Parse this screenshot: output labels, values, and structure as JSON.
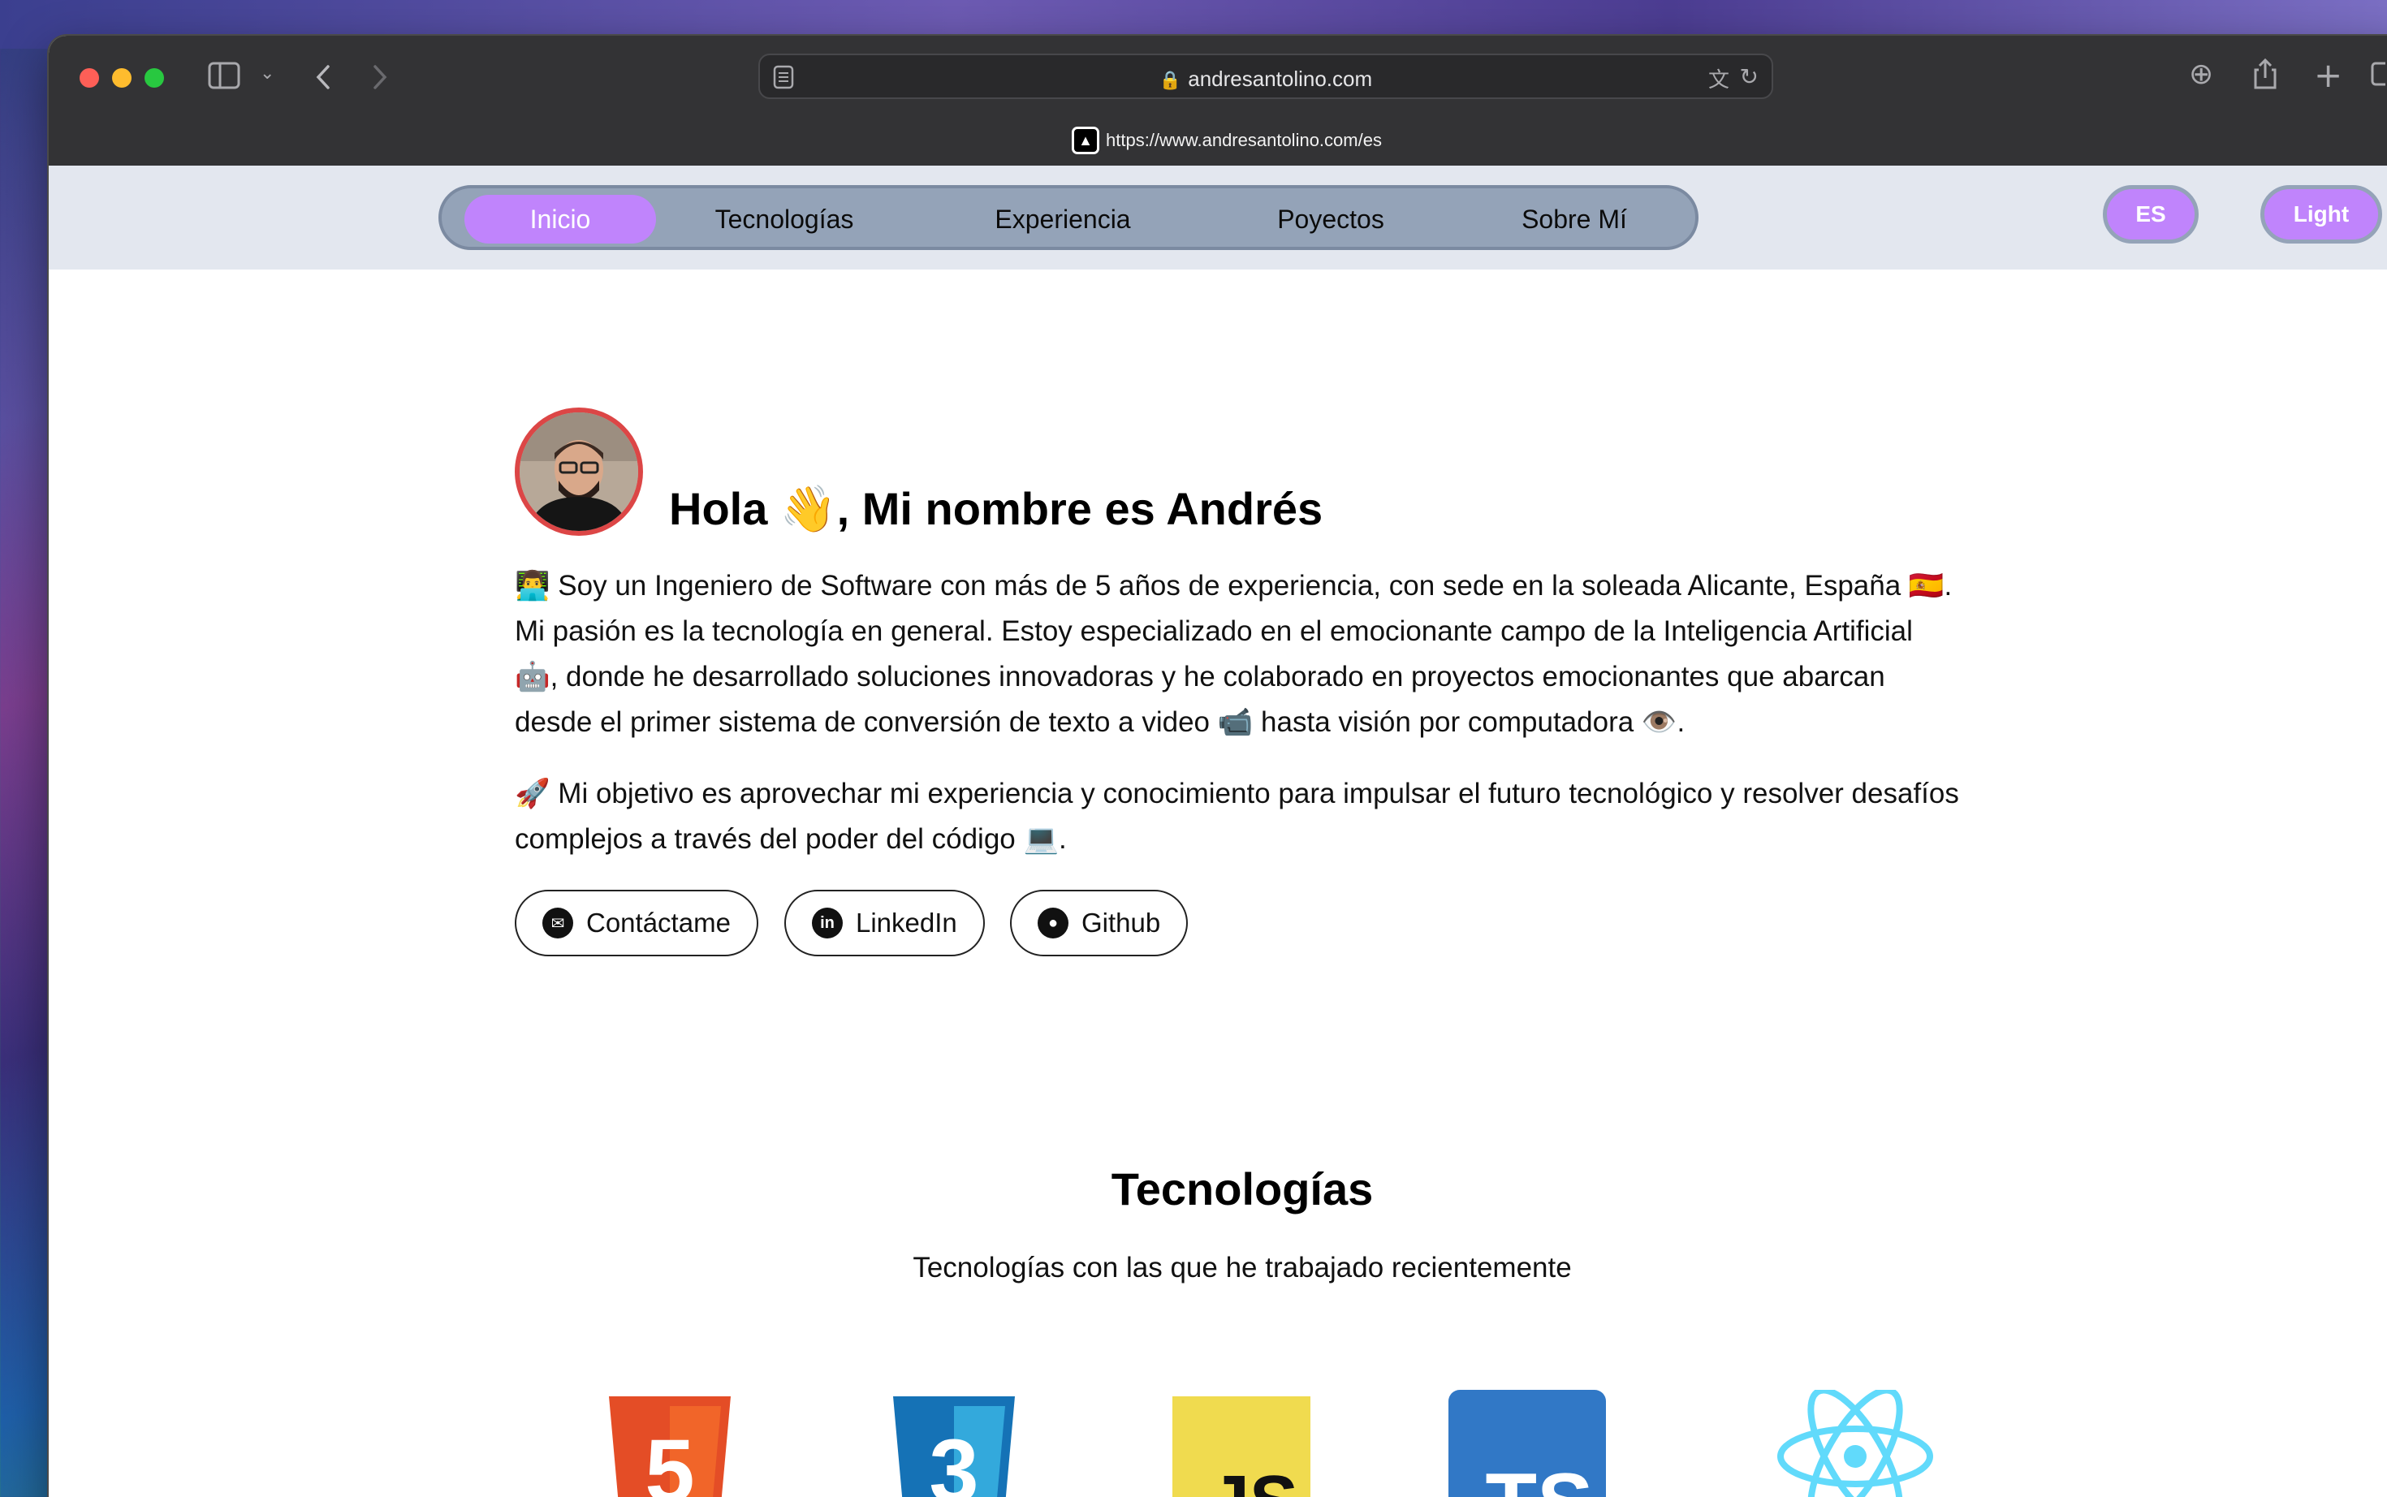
{
  "browser": {
    "url_display": "andresantolino.com",
    "hover_url": "https://www.andresantolino.com/es"
  },
  "nav": {
    "items": [
      {
        "label": "Inicio"
      },
      {
        "label": "Tecnologías"
      },
      {
        "label": "Experiencia"
      },
      {
        "label": "Poyectos"
      },
      {
        "label": "Sobre Mí"
      }
    ],
    "lang_label": "ES",
    "theme_label": "Light"
  },
  "hero": {
    "title_prefix": "Hola",
    "title_emoji": "👋",
    "title_suffix": ", Mi nombre es Andrés",
    "para1": "👨‍💻 Soy un Ingeniero de Software con más de 5 años de experiencia, con sede en la soleada Alicante, España 🇪🇸. Mi pasión es la tecnología en general. Estoy especializado en el emocionante campo de la Inteligencia Artificial 🤖, donde he desarrollado soluciones innovadoras y he colaborado en proyectos emocionantes que abarcan desde el primer sistema de conversión de texto a video 📹 hasta visión por computadora 👁️.",
    "para2": "🚀 Mi objetivo es aprovechar mi experiencia y conocimiento para impulsar el futuro tecnológico y resolver desafíos complejos a través del poder del código 💻.",
    "buttons": [
      {
        "label": "Contáctame",
        "icon": "mail-icon"
      },
      {
        "label": "LinkedIn",
        "icon": "linkedin-icon"
      },
      {
        "label": "Github",
        "icon": "github-icon"
      }
    ]
  },
  "technologies": {
    "title": "Tecnologías",
    "subtitle": "Tecnologías con las que he trabajado recientemente",
    "logos": [
      {
        "name": "html5-icon",
        "glyph": "5",
        "color": "#e44d26"
      },
      {
        "name": "css3-icon",
        "glyph": "3",
        "color": "#1572b6"
      },
      {
        "name": "javascript-icon",
        "glyph": "JS",
        "color": "#f0db4f"
      },
      {
        "name": "typescript-icon",
        "glyph": "TS",
        "color": "#3178c6"
      },
      {
        "name": "react-icon",
        "glyph": "",
        "color": "#61dafb"
      }
    ]
  },
  "colors": {
    "accent": "#c084fc",
    "nav_bg": "#94a3b8",
    "avatar_ring": "#dc4646"
  }
}
